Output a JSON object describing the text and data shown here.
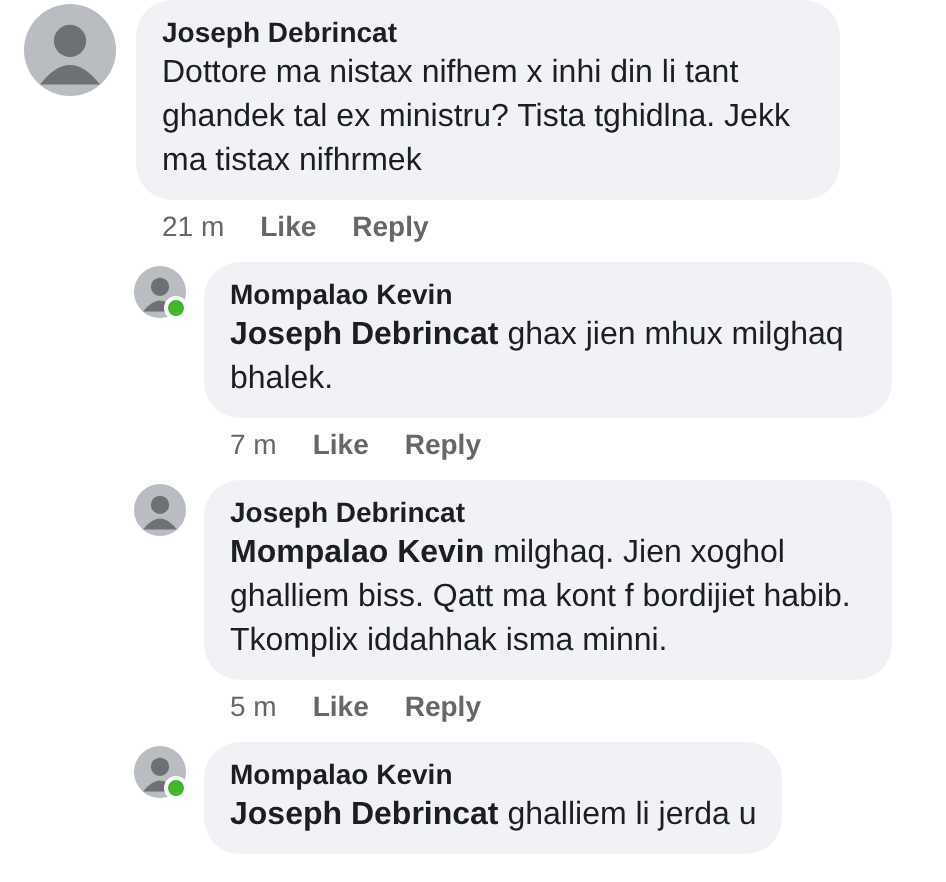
{
  "comments": [
    {
      "author": "Joseph Debrincat",
      "text": "Dottore ma nistax nifhem x inhi din li tant ghandek tal ex ministru? Tista tghidlna. Jekk ma tistax nifhrmek",
      "time": "21 m",
      "actions": [
        "Like",
        "Reply"
      ],
      "online": false,
      "children": [
        {
          "author": "Mompalao Kevin",
          "text": "**Joseph Debrincat** ghax jien mhux milghaq bhalek.",
          "time": "7 m",
          "actions": [
            "Like",
            "Reply"
          ],
          "online": true
        },
        {
          "author": "Joseph Debrincat",
          "text": "**Mompalao Kevin** milghaq. Jien xoghol ghalliem biss. Qatt ma kont f bordijiet habib. Tkomplix iddahhak isma minni.",
          "time": "5 m",
          "actions": [
            "Like",
            "Reply"
          ],
          "online": false
        },
        {
          "author": "Mompalao Kevin",
          "text": "**Joseph Debrincat** ghalliem li jerda u",
          "online": true
        }
      ]
    }
  ]
}
